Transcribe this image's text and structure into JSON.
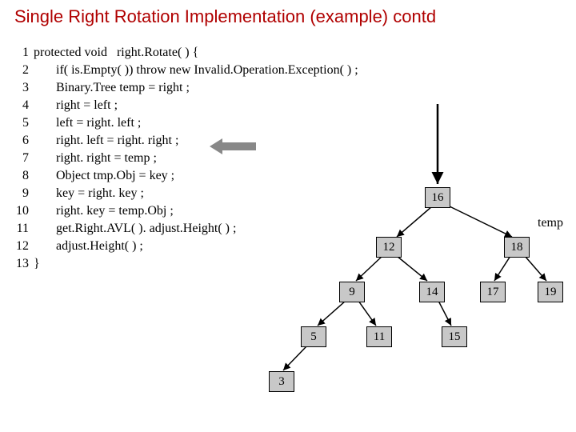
{
  "title": "Single Right Rotation Implementation (example) contd",
  "code": {
    "l1": {
      "n": "1",
      "t": "protected void   right.Rotate( ) {"
    },
    "l2": {
      "n": "2",
      "t": "if( is.Empty( )) throw new Invalid.Operation.Exception( ) ;"
    },
    "l3": {
      "n": "3",
      "t": "Binary.Tree temp = right ;"
    },
    "l4": {
      "n": "4",
      "t": "right = left ;"
    },
    "l5": {
      "n": "5",
      "t": "left = right. left ;"
    },
    "l6": {
      "n": "6",
      "t": "right. left = right. right ;"
    },
    "l7": {
      "n": "7",
      "t": "right. right = temp ;"
    },
    "l8": {
      "n": "8",
      "t": "Object tmp.Obj = key ;"
    },
    "l9": {
      "n": "9",
      "t": "key = right. key ;"
    },
    "l10": {
      "n": "10",
      "t": "right. key = temp.Obj ;"
    },
    "l11": {
      "n": "11",
      "t": "get.Right.AVL( ). adjust.Height( ) ;"
    },
    "l12": {
      "n": "12",
      "t": "adjust.Height( ) ;"
    },
    "l13": {
      "n": "13",
      "t": "}"
    }
  },
  "tree": {
    "temp_label": "temp",
    "nodes": {
      "n16": "16",
      "n12": "12",
      "n18": "18",
      "n9": "9",
      "n14": "14",
      "n17": "17",
      "n19": "19",
      "n5": "5",
      "n11": "11",
      "n15": "15",
      "n3": "3"
    }
  }
}
